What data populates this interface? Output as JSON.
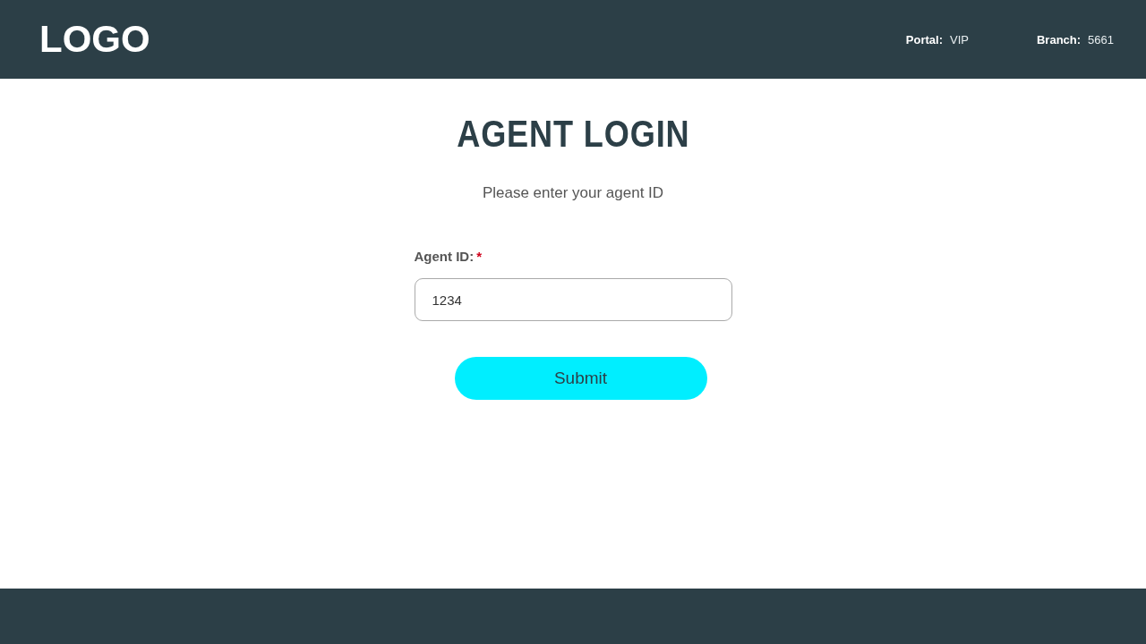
{
  "header": {
    "logo": "LOGO",
    "info": [
      {
        "label": "Portal:",
        "value": "VIP"
      },
      {
        "label": "Branch:",
        "value": "5661"
      }
    ]
  },
  "login": {
    "title": "AGENT LOGIN",
    "subtitle": "Please enter your agent ID",
    "field": {
      "label": "Agent ID:",
      "required_mark": "*",
      "value": "1234"
    },
    "submit": "Submit"
  }
}
